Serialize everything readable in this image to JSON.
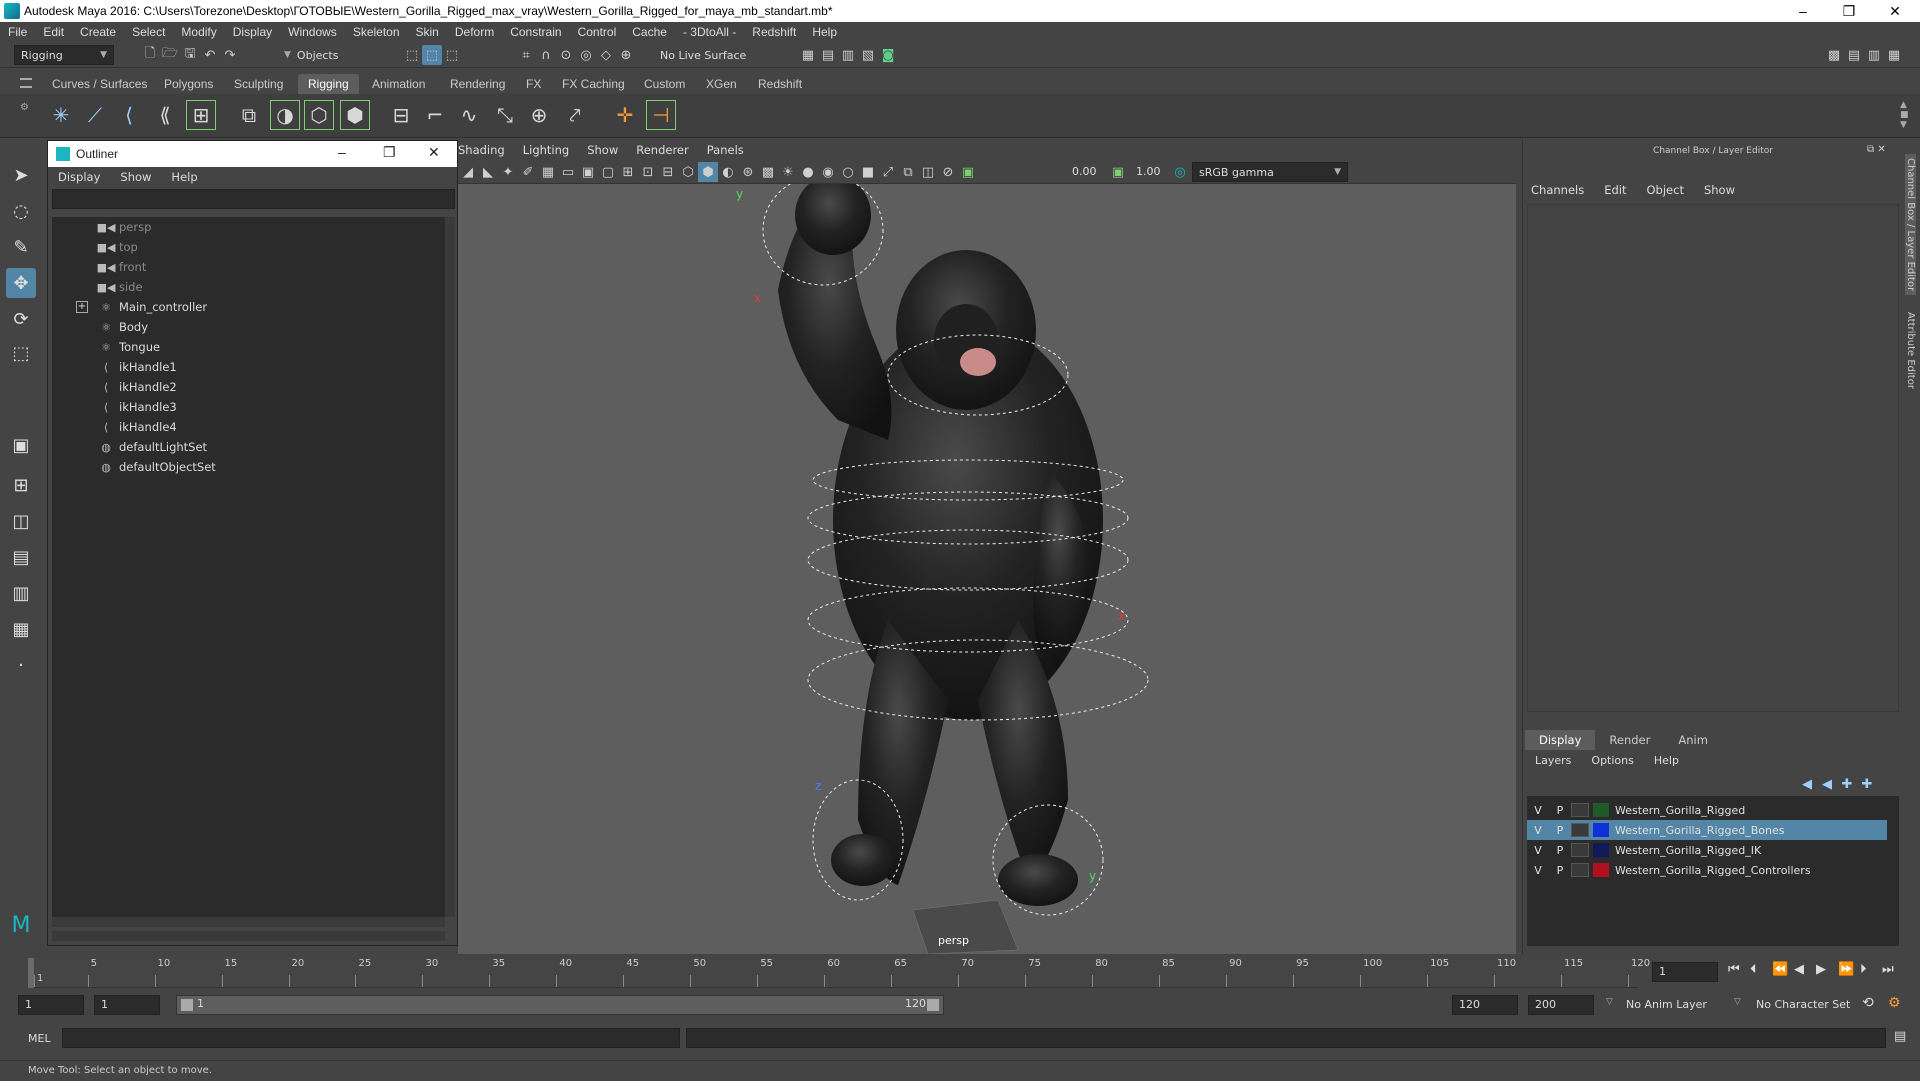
{
  "window": {
    "title": "Autodesk Maya 2016: C:\\Users\\Torezone\\Desktop\\ГОТОВЫЕ\\Western_Gorilla_Rigged_max_vray\\Western_Gorilla_Rigged_for_maya_mb_standart.mb*",
    "minimize": "–",
    "restore": "❐",
    "close": "✕"
  },
  "menubar": [
    "File",
    "Edit",
    "Create",
    "Select",
    "Modify",
    "Display",
    "Windows",
    "Skeleton",
    "Skin",
    "Deform",
    "Constrain",
    "Control",
    "Cache",
    "- 3DtoAll -",
    "Redshift",
    "Help"
  ],
  "statusline": {
    "menuset": "Rigging",
    "select_mode": "Objects",
    "live_surface": "No Live Surface"
  },
  "shelf_tabs": [
    "Curves / Surfaces",
    "Polygons",
    "Sculpting",
    "Rigging",
    "Animation",
    "Rendering",
    "FX",
    "FX Caching",
    "Custom",
    "XGen",
    "Redshift"
  ],
  "shelf_active": "Rigging",
  "outliner": {
    "title": "Outliner",
    "menus": [
      "Display",
      "Show",
      "Help"
    ],
    "items": [
      {
        "label": "persp",
        "type": "camera"
      },
      {
        "label": "top",
        "type": "camera"
      },
      {
        "label": "front",
        "type": "camera"
      },
      {
        "label": "side",
        "type": "camera"
      },
      {
        "label": "Main_controller",
        "type": "transform"
      },
      {
        "label": "Body",
        "type": "transform"
      },
      {
        "label": "Tongue",
        "type": "transform"
      },
      {
        "label": "ikHandle1",
        "type": "ik"
      },
      {
        "label": "ikHandle2",
        "type": "ik"
      },
      {
        "label": "ikHandle3",
        "type": "ik"
      },
      {
        "label": "ikHandle4",
        "type": "ik"
      },
      {
        "label": "defaultLightSet",
        "type": "set"
      },
      {
        "label": "defaultObjectSet",
        "type": "set"
      }
    ],
    "expander": "+"
  },
  "viewport": {
    "menus": [
      "Shading",
      "Lighting",
      "Show",
      "Renderer",
      "Panels"
    ],
    "exposure": "0.00",
    "gamma": "1.00",
    "colorspace": "sRGB gamma",
    "camera": "persp",
    "axis_labels": {
      "y": "y",
      "x": "x",
      "z": "z"
    }
  },
  "channelbox": {
    "title": "Channel Box / Layer Editor",
    "menus": [
      "Channels",
      "Edit",
      "Object",
      "Show"
    ],
    "layer_tabs": [
      "Display",
      "Render",
      "Anim"
    ],
    "layer_tab_active": "Display",
    "layer_menus": [
      "Layers",
      "Options",
      "Help"
    ],
    "layers": [
      {
        "name": "Western_Gorilla_Rigged",
        "color": "#1f5a2a",
        "v": "V",
        "p": "P",
        "selected": false
      },
      {
        "name": "Western_Gorilla_Rigged_Bones",
        "color": "#1030d8",
        "v": "V",
        "p": "P",
        "selected": true
      },
      {
        "name": "Western_Gorilla_Rigged_IK",
        "color": "#101a5a",
        "v": "V",
        "p": "P",
        "selected": false
      },
      {
        "name": "Western_Gorilla_Rigged_Controllers",
        "color": "#b01020",
        "v": "V",
        "p": "P",
        "selected": false
      }
    ]
  },
  "side_tabs": [
    "Channel Box / Layer Editor",
    "Attribute Editor"
  ],
  "timeline": {
    "ticks": [
      "1",
      "5",
      "10",
      "15",
      "20",
      "25",
      "30",
      "35",
      "40",
      "45",
      "50",
      "55",
      "60",
      "65",
      "70",
      "75",
      "80",
      "85",
      "90",
      "95",
      "100",
      "105",
      "110",
      "115",
      "120"
    ],
    "current_frame": "1"
  },
  "range": {
    "start": "1",
    "playback_start": "1",
    "range_start_label": "1",
    "range_end_label": "120",
    "playback_end": "120",
    "end": "200",
    "anim_layer": "No Anim Layer",
    "character_set": "No Character Set"
  },
  "cmdline": {
    "lang": "MEL"
  },
  "helpline": "Move Tool: Select an object to move.",
  "colors": {
    "accent": "#5285a6",
    "panel": "#444444",
    "dark": "#2b2b2b",
    "viewport": "#5e5e5e"
  }
}
